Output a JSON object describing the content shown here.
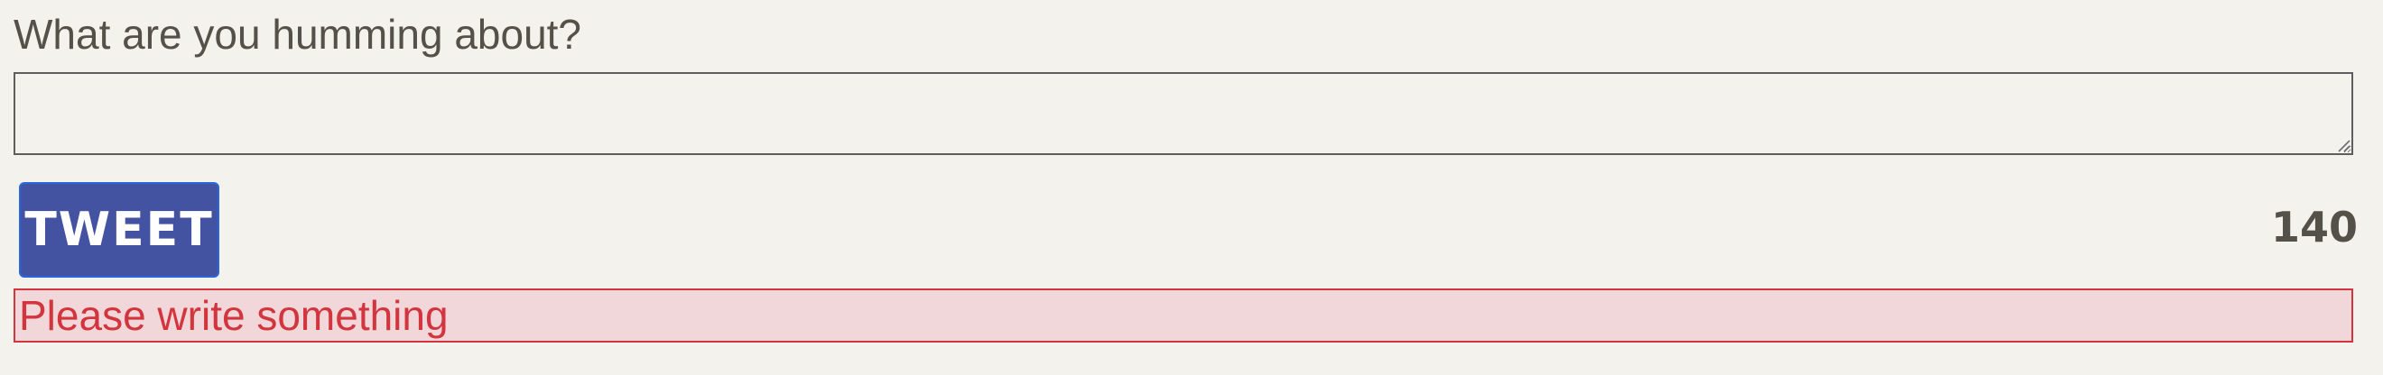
{
  "compose": {
    "prompt": "What are you humming about?",
    "textarea_value": "",
    "button_label": "TWEET",
    "remaining_chars": "140",
    "error_message": "Please write something"
  },
  "colors": {
    "background": "#f3f2ed",
    "button_fill": "#4453a1",
    "button_border": "#2a66d9",
    "error_text": "#d2353d",
    "error_fill": "#f2d7da",
    "label_text": "#545148"
  },
  "icons": {
    "textarea_resize": "resize-grip-icon"
  }
}
